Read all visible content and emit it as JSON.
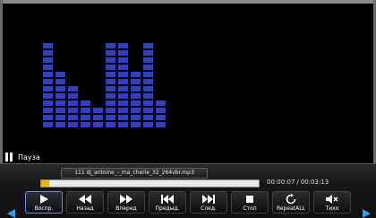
{
  "status": {
    "label": "Пауза"
  },
  "track": {
    "filename": "111 dj_antoine_-_ma_cherie_32_264vbr.mp3",
    "elapsed": "00:00:07",
    "separator": "/",
    "duration": "00:03:13",
    "progress_fraction": 0.036
  },
  "visualizer": {
    "column_levels": [
      12,
      8,
      6,
      4,
      3,
      12,
      12,
      8,
      12,
      4
    ],
    "color": "#3341b5"
  },
  "controls": {
    "buttons": [
      {
        "label": "Воспр.",
        "icon": "play-icon"
      },
      {
        "label": "Назад",
        "icon": "rewind-icon"
      },
      {
        "label": "Вперед",
        "icon": "fast-forward-icon"
      },
      {
        "label": "Предыд.",
        "icon": "previous-track-icon"
      },
      {
        "label": "След.",
        "icon": "next-track-icon"
      },
      {
        "label": "Стоп",
        "icon": "stop-icon"
      },
      {
        "label": "RepeatALL",
        "icon": "repeat-icon"
      },
      {
        "label": "Тихо",
        "icon": "mute-icon"
      }
    ],
    "selected_index": 0
  },
  "colors": {
    "accent": "#2a9df4",
    "progress": "#f0b400",
    "selection_border": "#6f8fd0"
  }
}
